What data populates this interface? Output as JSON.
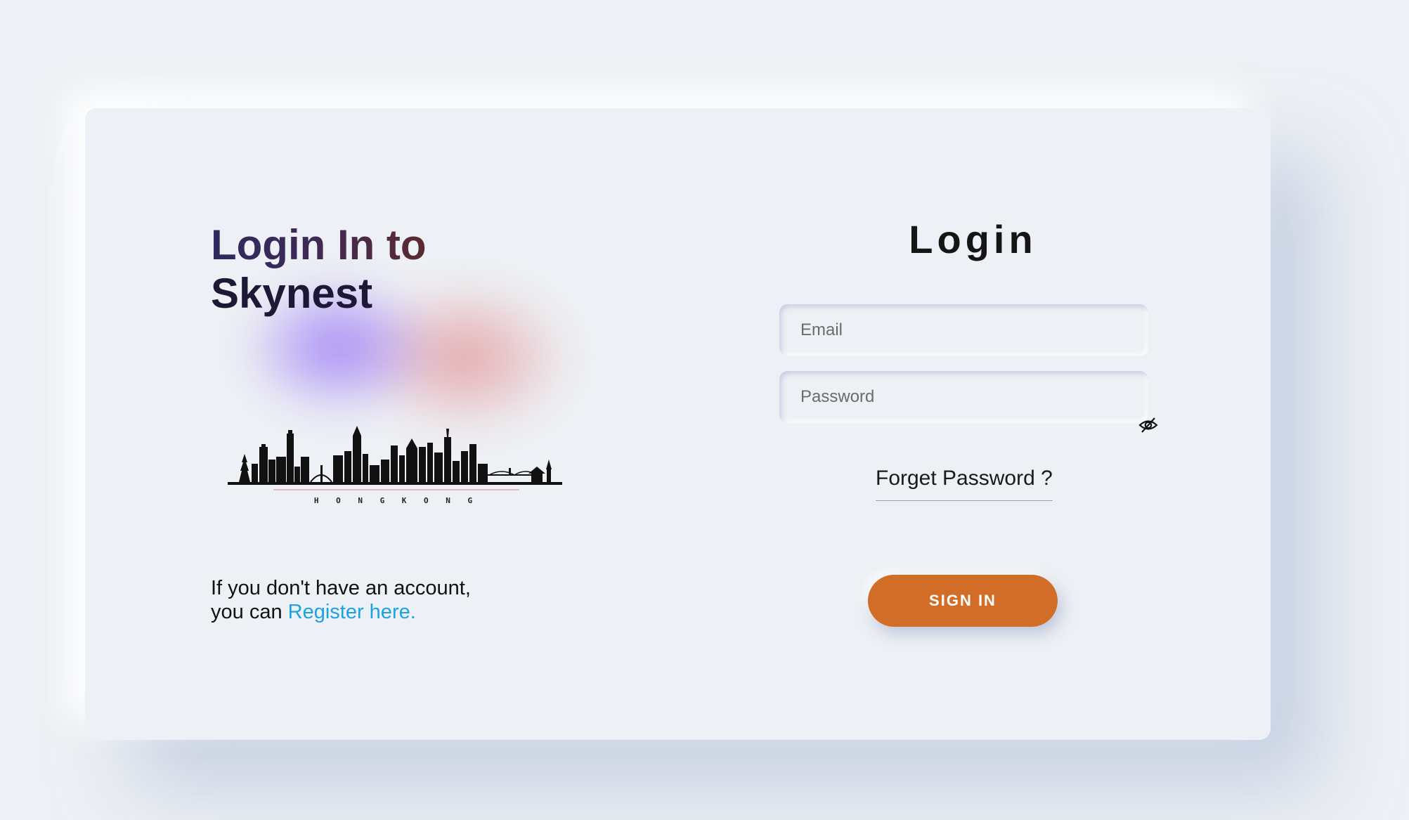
{
  "left": {
    "headline_line1": "Login In to",
    "headline_line2": "Skynest",
    "skyline_caption": "H O N G   K O N G",
    "register_text_line1": "If you don't have an account,",
    "register_text_prefix": "you can ",
    "register_link": "Register here."
  },
  "form": {
    "title": "Login",
    "email_placeholder": "Email",
    "password_placeholder": "Password",
    "password_toggle_icon": "eye-slash-icon",
    "forgot_label": "Forget Password ?",
    "signin_label": "SIGN IN"
  },
  "colors": {
    "background": "#edf0f4",
    "accent_button": "#d16d26",
    "link": "#1aa3e0"
  }
}
